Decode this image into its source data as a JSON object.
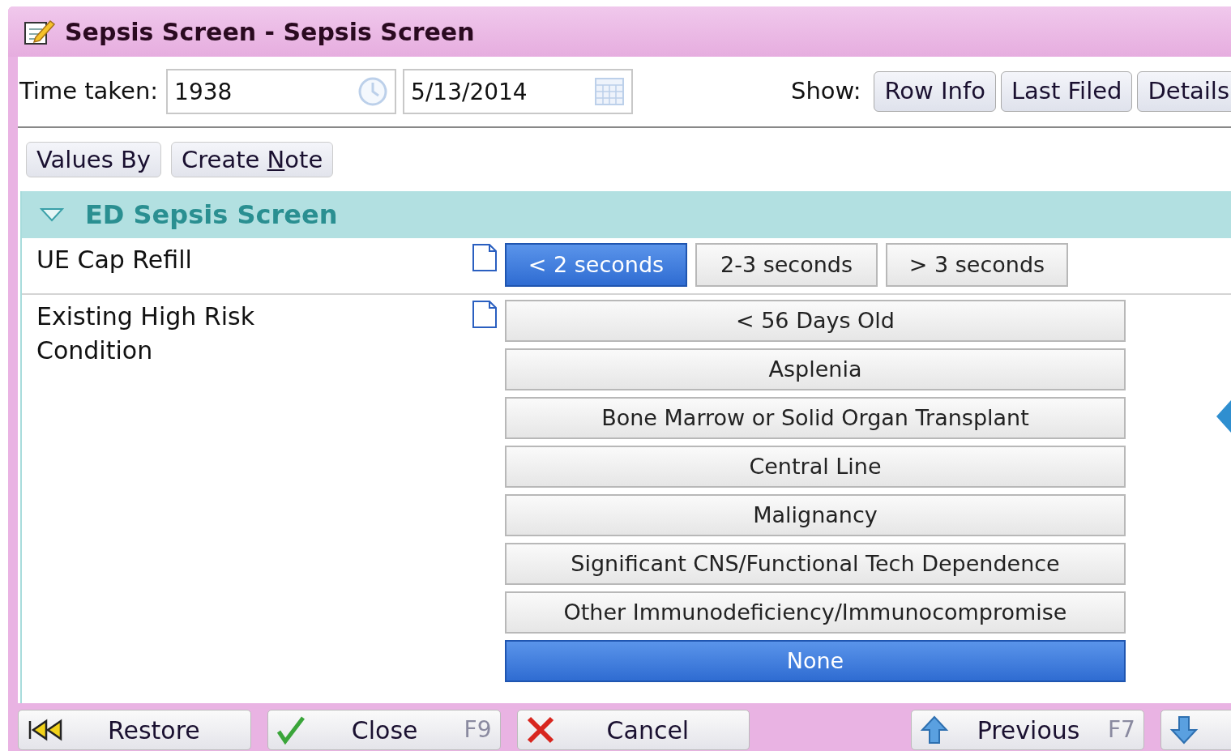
{
  "window": {
    "title": "Sepsis Screen - Sepsis Screen"
  },
  "toolbar": {
    "time_label": "Time taken:",
    "time_value": "1938",
    "date_value": "5/13/2014",
    "show_label": "Show:",
    "show_buttons": [
      "Row Info",
      "Last Filed",
      "Details"
    ]
  },
  "actions": [
    {
      "label_before": "Values By"
    },
    {
      "label_before": "Create ",
      "accelerator": "N",
      "label_after": "ote"
    }
  ],
  "section": {
    "title": "ED Sepsis Screen",
    "expanded": true
  },
  "rows": [
    {
      "label": "UE Cap Refill",
      "kind": "single",
      "options": [
        {
          "label": "< 2 seconds",
          "selected": true
        },
        {
          "label": "2-3 seconds",
          "selected": false
        },
        {
          "label": "> 3 seconds",
          "selected": false
        }
      ]
    },
    {
      "label": "Existing High Risk Condition",
      "kind": "multi",
      "options": [
        {
          "label": "< 56 Days Old",
          "selected": false
        },
        {
          "label": "Asplenia",
          "selected": false
        },
        {
          "label": "Bone Marrow or Solid Organ Transplant",
          "selected": false
        },
        {
          "label": "Central Line",
          "selected": false
        },
        {
          "label": "Malignancy",
          "selected": false
        },
        {
          "label": "Significant CNS/Functional Tech Dependence",
          "selected": false
        },
        {
          "label": "Other Immunodeficiency/Immunocompromise",
          "selected": false
        },
        {
          "label": "None",
          "selected": true
        }
      ]
    }
  ],
  "footer": [
    {
      "kind": "restore",
      "label": "Restore"
    },
    {
      "kind": "close",
      "label": "Close",
      "key": "F9"
    },
    {
      "kind": "cancel",
      "label": "Cancel"
    },
    {
      "kind": "previous",
      "label": "Previous",
      "key": "F7"
    },
    {
      "kind": "next"
    }
  ]
}
